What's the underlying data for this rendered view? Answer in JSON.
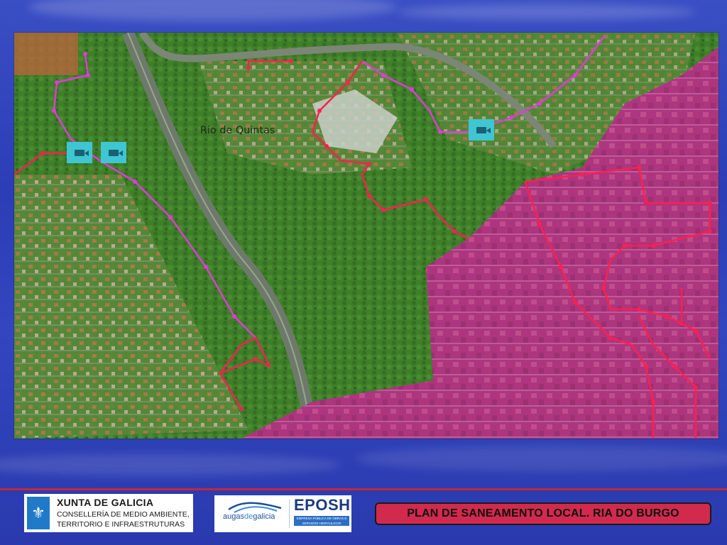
{
  "map": {
    "river_label": "Rio de Quintas",
    "colors": {
      "vegetation": "#3f7f2a",
      "urban_zone": "#b02a8a",
      "network_red": "#ff1f4f",
      "network_magenta": "#e23ad9",
      "camera_icon": "#3ec6d2"
    },
    "icons": [
      "camera-icon",
      "camera-icon",
      "camera-icon"
    ]
  },
  "footer": {
    "xunta_title": "XUNTA DE GALICIA",
    "xunta_line1": "CONSELLERÍA DE MEDIO AMBIENTE,",
    "xunta_line2": "TERRITORIO E INFRAESTRUTURAS",
    "augas_name_a": "augas",
    "augas_name_b": "de",
    "augas_name_c": "galicia",
    "eposh": "EPOSH",
    "eposh_sub": "EMPRESA PÚBLICA DE OBRAS E SERVIZOS HIDRÁULICOS",
    "title": "PLAN DE SANEAMENTO LOCAL. RIA DO BURGO",
    "accent": "#c8263a"
  }
}
